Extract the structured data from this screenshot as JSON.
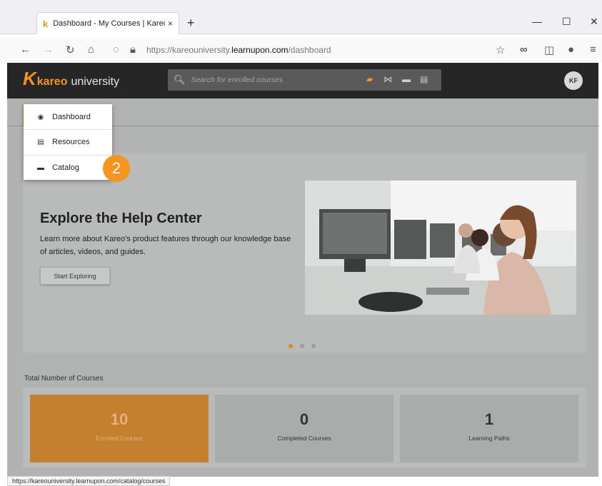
{
  "browser": {
    "tab_title": "Dashboard - My Courses | Kareo",
    "tab_close": "×",
    "favicon": "k",
    "new_tab": "+",
    "minimize": "—",
    "maximize": "☐",
    "close": "✕",
    "url_prefix": "https://kareouniversity.",
    "url_host": "learnupon.com",
    "url_path": "/dashboard",
    "status_url": "https://kareouniversity.learnupon.com/catalog/courses"
  },
  "header": {
    "logo_k": "K",
    "logo_kareo": "kareo",
    "logo_university": "university",
    "search_placeholder": "Search for enrolled courses",
    "avatar_initials": "KF"
  },
  "menu": {
    "items": [
      {
        "label": "Dashboard",
        "icon": "dashboard-icon"
      },
      {
        "label": "Resources",
        "icon": "document-icon"
      },
      {
        "label": "Catalog",
        "icon": "folder-icon"
      }
    ]
  },
  "annotation": {
    "step": "2"
  },
  "hero": {
    "title": "Explore the Help Center",
    "text": "Learn more about Kareo's product features through our knowledge base of articles, videos, and guides.",
    "button": "Start Exploring",
    "slides": 3,
    "active_slide": 1
  },
  "stats": {
    "section_label": "Total Number of Courses",
    "cards": [
      {
        "value": "10",
        "label": "Enrolled Courses"
      },
      {
        "value": "0",
        "label": "Completed Courses"
      },
      {
        "value": "1",
        "label": "Learning Paths"
      }
    ]
  },
  "colors": {
    "accent": "#f7941d",
    "header_bg": "#262626",
    "overlay_accent": "#c47f2f"
  }
}
